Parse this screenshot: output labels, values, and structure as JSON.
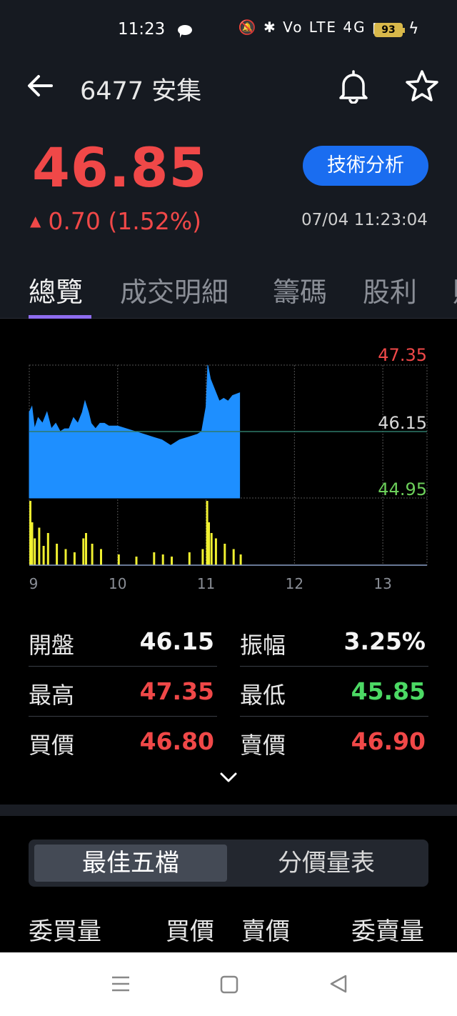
{
  "status_bar": {
    "time": "11:23",
    "icons_text": "🔕 ✱ Vo LTE 4G ▮▮▮",
    "battery": "93",
    "icons": [
      "chat-icon",
      "mute-icon",
      "bluetooth-icon",
      "volte-icon",
      "signal-icon",
      "battery-icon",
      "charging-icon"
    ]
  },
  "header": {
    "title": "6477 安集",
    "price": "46.85",
    "change": "0.70 (1.52%)",
    "change_arrow": "▲",
    "button_label": "技術分析",
    "timestamp": "07/04 11:23:04"
  },
  "tabs": [
    "總覽",
    "成交明細",
    "籌碼",
    "股利",
    "財"
  ],
  "chart": {
    "high_label": "47.35",
    "ref_label": "46.15",
    "low_label": "44.95",
    "x_labels": [
      "9",
      "10",
      "11",
      "12",
      "13"
    ],
    "colors": {
      "price_fill": "#1e8fff",
      "volume": "#f0f030",
      "high": "#f04848",
      "low": "#6ccf5a",
      "ref_line": "#2f7a6a"
    }
  },
  "chart_data": {
    "type": "area",
    "ylim": [
      44.95,
      47.35
    ],
    "reference": 46.15,
    "xlim": [
      9,
      13.5
    ],
    "x_ticks": [
      9,
      10,
      11,
      12,
      13
    ],
    "series": [
      {
        "values": [
          [
            9.0,
            46.5
          ],
          [
            9.03,
            46.6
          ],
          [
            9.06,
            46.2
          ],
          [
            9.1,
            46.4
          ],
          [
            9.15,
            46.3
          ],
          [
            9.2,
            46.5
          ],
          [
            9.25,
            46.2
          ],
          [
            9.3,
            46.3
          ],
          [
            9.35,
            46.15
          ],
          [
            9.4,
            46.2
          ],
          [
            9.45,
            46.2
          ],
          [
            9.5,
            46.4
          ],
          [
            9.55,
            46.3
          ],
          [
            9.6,
            46.5
          ],
          [
            9.63,
            46.7
          ],
          [
            9.67,
            46.5
          ],
          [
            9.7,
            46.3
          ],
          [
            9.75,
            46.2
          ],
          [
            9.8,
            46.3
          ],
          [
            9.85,
            46.3
          ],
          [
            9.9,
            46.25
          ],
          [
            10.0,
            46.25
          ],
          [
            10.1,
            46.2
          ],
          [
            10.2,
            46.15
          ],
          [
            10.3,
            46.1
          ],
          [
            10.4,
            46.05
          ],
          [
            10.5,
            46.0
          ],
          [
            10.55,
            45.95
          ],
          [
            10.6,
            45.9
          ],
          [
            10.65,
            45.95
          ],
          [
            10.7,
            46.0
          ],
          [
            10.8,
            46.05
          ],
          [
            10.9,
            46.1
          ],
          [
            10.95,
            46.15
          ],
          [
            11.0,
            46.6
          ],
          [
            11.02,
            47.35
          ],
          [
            11.05,
            47.1
          ],
          [
            11.1,
            46.9
          ],
          [
            11.15,
            46.7
          ],
          [
            11.2,
            46.75
          ],
          [
            11.25,
            46.7
          ],
          [
            11.3,
            46.8
          ],
          [
            11.38,
            46.85
          ]
        ]
      },
      {
        "values": [
          [
            9.0,
            60
          ],
          [
            9.02,
            40
          ],
          [
            9.05,
            25
          ],
          [
            9.1,
            35
          ],
          [
            9.15,
            18
          ],
          [
            9.2,
            30
          ],
          [
            9.3,
            20
          ],
          [
            9.4,
            15
          ],
          [
            9.5,
            12
          ],
          [
            9.6,
            25
          ],
          [
            9.63,
            30
          ],
          [
            9.7,
            20
          ],
          [
            9.8,
            15
          ],
          [
            10.0,
            10
          ],
          [
            10.2,
            8
          ],
          [
            10.4,
            12
          ],
          [
            10.5,
            10
          ],
          [
            10.6,
            8
          ],
          [
            10.8,
            12
          ],
          [
            10.95,
            15
          ],
          [
            11.0,
            60
          ],
          [
            11.02,
            40
          ],
          [
            11.05,
            30
          ],
          [
            11.1,
            25
          ],
          [
            11.2,
            20
          ],
          [
            11.3,
            15
          ],
          [
            11.38,
            10
          ]
        ]
      }
    ]
  },
  "stats": {
    "rows": [
      {
        "l_label": "開盤",
        "l_value": "46.15",
        "r_label": "振幅",
        "r_value": "3.25%"
      },
      {
        "l_label": "最高",
        "l_value": "47.35",
        "r_label": "最低",
        "r_value": "45.85"
      },
      {
        "l_label": "買價",
        "l_value": "46.80",
        "r_label": "賣價",
        "r_value": "46.90"
      }
    ],
    "colors": {
      "white": "#f5f5f5",
      "red": "#f04848",
      "green": "#4cd964"
    }
  },
  "segmented": {
    "active": "最佳五檔",
    "inactive": "分價量表"
  },
  "book_headers": {
    "bid_vol": "委買量",
    "bid": "買價",
    "ask": "賣價",
    "ask_vol": "委賣量"
  },
  "nav_bar": {
    "icons": [
      "menu-icon",
      "home-icon",
      "back-triangle-icon"
    ]
  }
}
